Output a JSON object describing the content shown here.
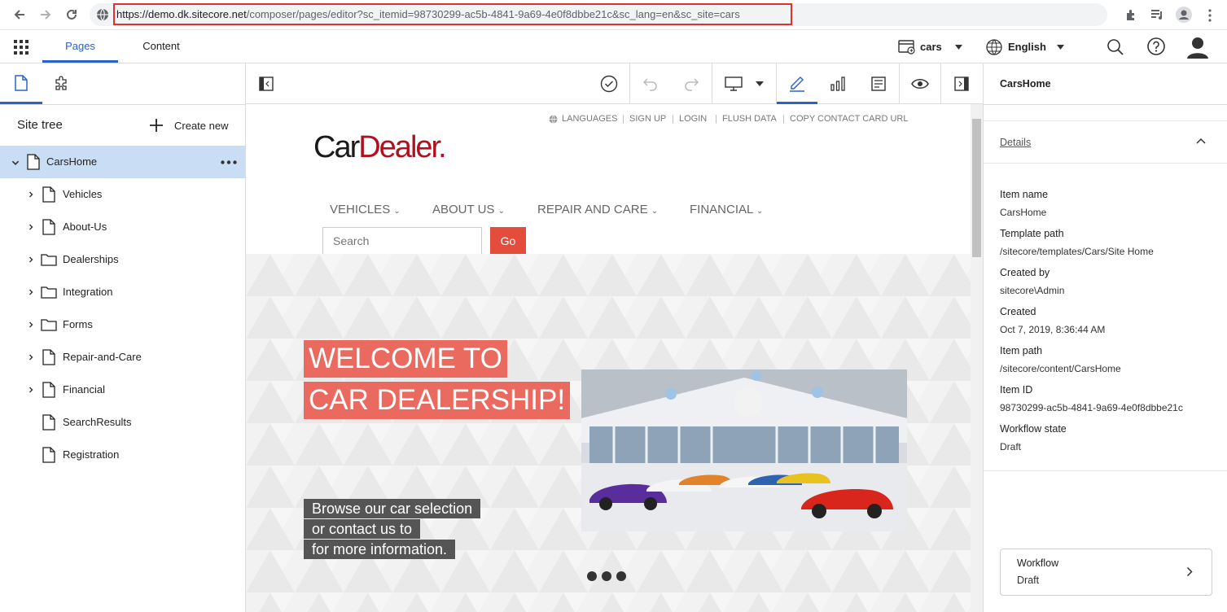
{
  "browser": {
    "url_host": "https://demo.dk.sitecore.net",
    "url_path": "/composer/pages/editor?sc_itemid=98730299-ac5b-4841-9a69-4e0f8dbbe21c&sc_lang=en&sc_site=cars",
    "icons": [
      "back-icon",
      "forward-icon",
      "reload-icon",
      "site-info-icon",
      "extensions-icon",
      "reading-list-icon",
      "profile-icon"
    ]
  },
  "header": {
    "tabs": [
      {
        "label": "Pages",
        "active": true
      },
      {
        "label": "Content",
        "active": false
      }
    ],
    "site_selector": "cars",
    "language_selector": "English"
  },
  "sidebar": {
    "title": "Site tree",
    "create_new": "Create new",
    "root": "CarsHome",
    "items": [
      {
        "label": "Vehicles",
        "type": "page",
        "expandable": true
      },
      {
        "label": "About-Us",
        "type": "page",
        "expandable": true
      },
      {
        "label": "Dealerships",
        "type": "folder",
        "expandable": true
      },
      {
        "label": "Integration",
        "type": "folder",
        "expandable": true
      },
      {
        "label": "Forms",
        "type": "folder",
        "expandable": true
      },
      {
        "label": "Repair-and-Care",
        "type": "page",
        "expandable": true
      },
      {
        "label": "Financial",
        "type": "page",
        "expandable": true
      },
      {
        "label": "SearchResults",
        "type": "page",
        "expandable": false
      },
      {
        "label": "Registration",
        "type": "page",
        "expandable": false
      }
    ]
  },
  "site": {
    "top_links": [
      "LANGUAGES",
      "SIGN UP",
      "LOGIN",
      "FLUSH DATA",
      "COPY CONTACT CARD URL"
    ],
    "logo_left": "Car",
    "logo_right": "Dealer.",
    "nav": [
      "VEHICLES",
      "ABOUT US",
      "REPAIR AND CARE",
      "FINANCIAL"
    ],
    "search_placeholder": "Search",
    "search_button": "Go",
    "hero_title_line1": "WELCOME TO",
    "hero_title_line2": "CAR DEALERSHIP!",
    "hero_text_line1": "Browse our car selection",
    "hero_text_line2": "or contact us to",
    "hero_text_line3": "for more information.",
    "carousel_dots": 3
  },
  "details": {
    "item_title": "CarsHome",
    "section_label": "Details",
    "fields": [
      {
        "label": "Item name",
        "value": "CarsHome"
      },
      {
        "label": "Template path",
        "value": "/sitecore/templates/Cars/Site Home"
      },
      {
        "label": "Created by",
        "value": "sitecore\\Admin"
      },
      {
        "label": "Created",
        "value": "Oct 7, 2019, 8:36:44 AM"
      },
      {
        "label": "Item path",
        "value": "/sitecore/content/CarsHome"
      },
      {
        "label": "Item ID",
        "value": "98730299-ac5b-4841-9a69-4e0f8dbbe21c"
      },
      {
        "label": "Workflow state",
        "value": "Draft"
      }
    ],
    "workflow_label": "Workflow",
    "workflow_value": "Draft"
  },
  "colors": {
    "accent": "#2a63c6",
    "selected_row": "#c9def5",
    "hero_red": "#ea5c50",
    "go_button": "#e44c3c",
    "logo_dark": "#1a1a1a",
    "logo_red": "#b0111e"
  }
}
